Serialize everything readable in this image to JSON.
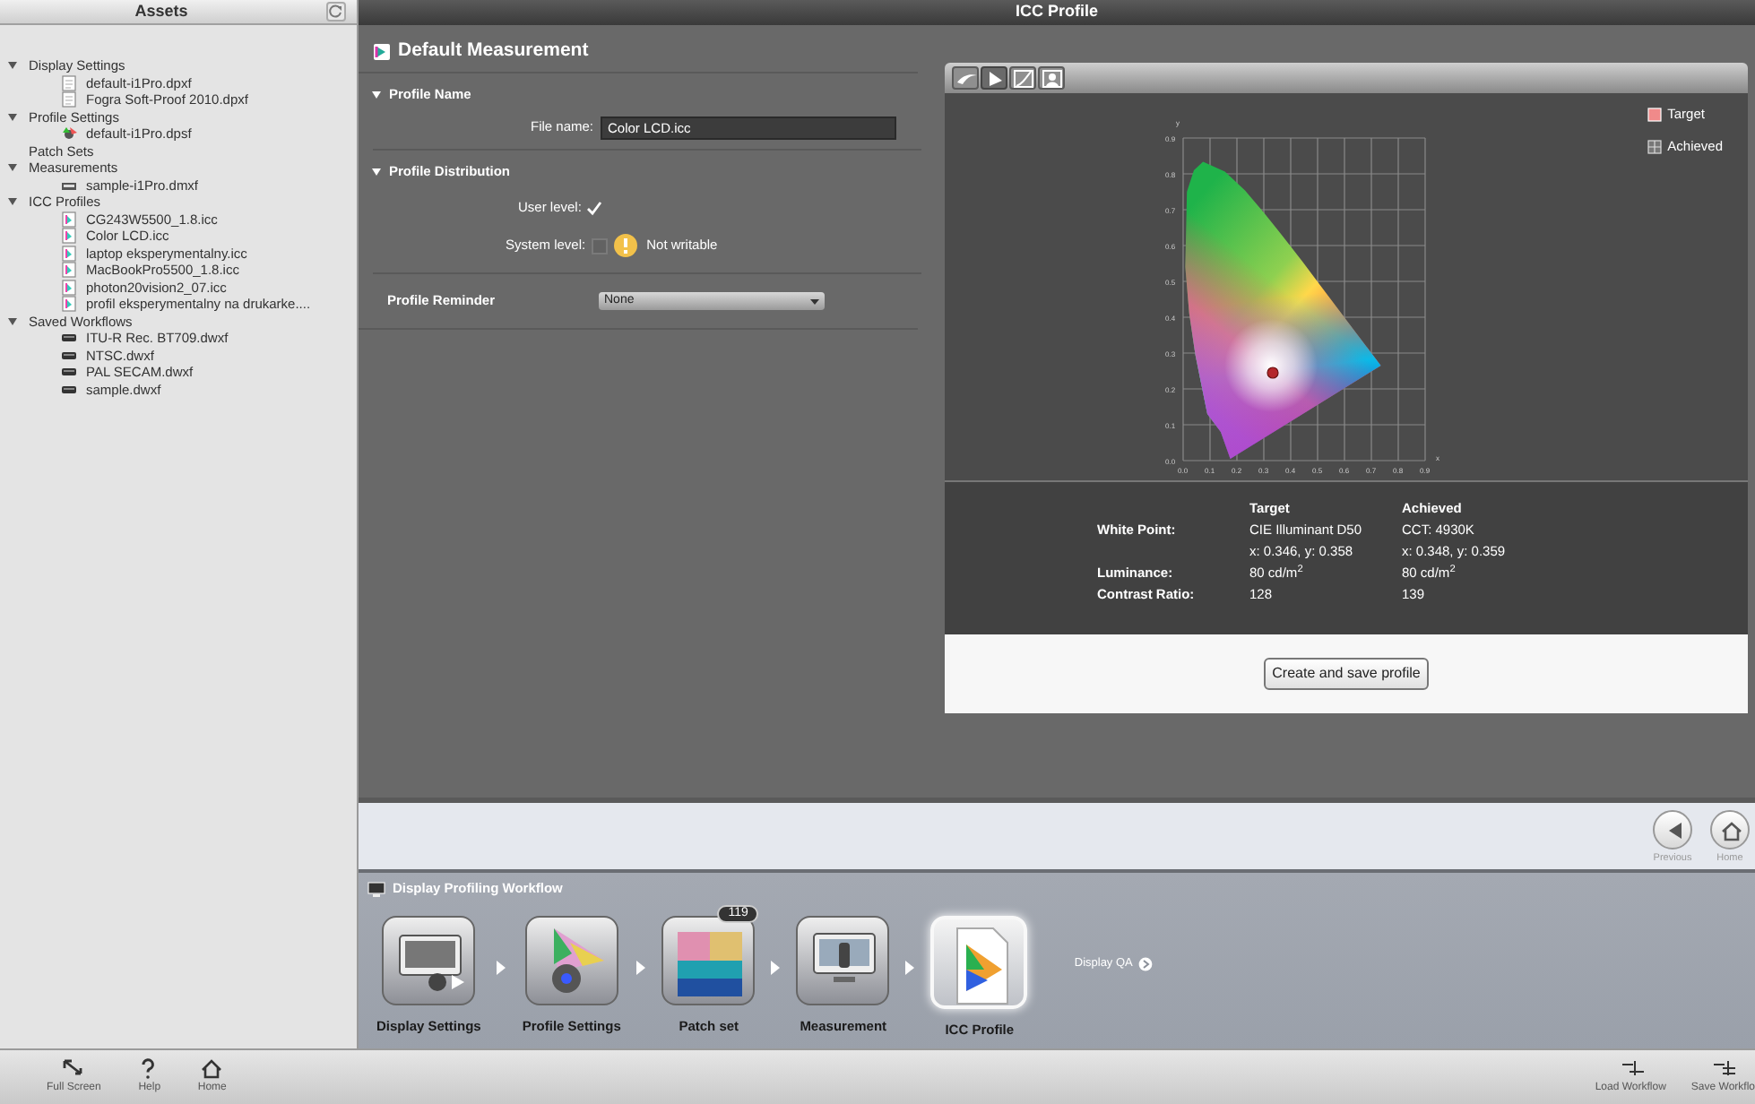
{
  "sidebar": {
    "title": "Assets",
    "items": [
      {
        "label": "Display Settings",
        "expanded": true,
        "children": [
          {
            "label": "default-i1Pro.dpxf",
            "kind": "document"
          },
          {
            "label": "Fogra Soft-Proof 2010.dpxf",
            "kind": "document"
          }
        ]
      },
      {
        "label": "Profile Settings",
        "expanded": true,
        "children": [
          {
            "label": "default-i1Pro.dpsf",
            "kind": "settings"
          }
        ]
      },
      {
        "label": "Patch Sets"
      },
      {
        "label": "Measurements",
        "expanded": true,
        "children": [
          {
            "label": "sample-i1Pro.dmxf",
            "kind": "measurement"
          }
        ]
      },
      {
        "label": "ICC Profiles",
        "expanded": true,
        "children": [
          {
            "label": "CG243W5500_1.8.icc",
            "kind": "profile"
          },
          {
            "label": "Color LCD.icc",
            "kind": "profile"
          },
          {
            "label": "laptop eksperymentalny.icc",
            "kind": "profile"
          },
          {
            "label": "MacBookPro5500_1.8.icc",
            "kind": "profile"
          },
          {
            "label": "photon20vision2_07.icc",
            "kind": "profile"
          },
          {
            "label": "profil eksperymentalny na drukarke....",
            "kind": "profile"
          }
        ]
      },
      {
        "label": "Saved Workflows",
        "expanded": true,
        "children": [
          {
            "label": "ITU-R Rec. BT709.dwxf",
            "kind": "workflow"
          },
          {
            "label": "NTSC.dwxf",
            "kind": "workflow"
          },
          {
            "label": "PAL SECAM.dwxf",
            "kind": "workflow"
          },
          {
            "label": "sample.dwxf",
            "kind": "workflow"
          }
        ]
      }
    ]
  },
  "window": {
    "title": "ICC Profile"
  },
  "settings": {
    "title": "Default Measurement",
    "profile_name": {
      "title": "Profile Name",
      "expanded": true,
      "label": "File name:",
      "value": "Color LCD.icc"
    },
    "distribution": {
      "title": "Profile Distribution",
      "expanded": true,
      "user_level": {
        "label": "User level:",
        "checked": true
      },
      "system_level": {
        "label": "System level:",
        "checked": false,
        "warning": "Not writable"
      }
    },
    "reminder": {
      "label": "Profile Reminder",
      "value": "None"
    }
  },
  "viewer": {
    "tabs": [
      {
        "kind": "gamut",
        "selected": false
      },
      {
        "kind": "chromaticity",
        "selected": true
      },
      {
        "kind": "curve",
        "selected": false
      },
      {
        "kind": "person",
        "selected": false
      }
    ],
    "chart": {
      "y_axis_label": "y",
      "x_axis_label": "x",
      "yticks": [
        "0.9",
        "0.8",
        "0.7",
        "0.6",
        "0.5",
        "0.4",
        "0.3",
        "0.2",
        "0.1",
        "0.0"
      ],
      "xticks": [
        "0.0",
        "0.1",
        "0.2",
        "0.3",
        "0.4",
        "0.5",
        "0.6",
        "0.7",
        "0.8",
        "0.9"
      ]
    },
    "legend": [
      {
        "label": "Target",
        "kind": "target"
      },
      {
        "label": "Achieved",
        "kind": "achieved"
      }
    ],
    "table": {
      "columns": [
        "Target",
        "Achieved"
      ],
      "rows": [
        {
          "label": "White Point:",
          "target": "CIE Illuminant D50",
          "achieved": "CCT: 4930K"
        },
        {
          "target": "x: 0.346, y: 0.358",
          "achieved": "x: 0.348, y: 0.359"
        },
        {
          "label": "Luminance:",
          "target": "80 cd/m$^{2}$",
          "achieved": "80 cd/m$^{2}$"
        },
        {
          "label": "Contrast Ratio:",
          "target": "128",
          "achieved": "139"
        }
      ]
    },
    "button": "Create and save profile"
  },
  "nav": [
    {
      "label": "Previous",
      "kind": "previous"
    },
    {
      "label": "Home",
      "kind": "home"
    }
  ],
  "workflow": {
    "title": "Display Profiling Workflow",
    "steps": [
      {
        "label": "Display Settings",
        "kind": "display",
        "selected": false
      },
      {
        "label": "Profile Settings",
        "kind": "profile-settings",
        "selected": false
      },
      {
        "label": "Patch set",
        "kind": "patches",
        "selected": false,
        "badge": "119"
      },
      {
        "label": "Measurement",
        "kind": "measurement",
        "selected": false
      },
      {
        "label": "ICC Profile",
        "kind": "icc",
        "selected": true
      }
    ],
    "extra": "Display QA"
  },
  "toolbar_left": [
    {
      "label": "Full Screen",
      "kind": "fullscreen"
    },
    {
      "label": "Help",
      "kind": "help"
    },
    {
      "label": "Home",
      "kind": "home"
    }
  ],
  "toolbar_right": [
    {
      "label": "Load Workflow",
      "kind": "load"
    },
    {
      "label": "Save Workflo",
      "kind": "save"
    }
  ]
}
